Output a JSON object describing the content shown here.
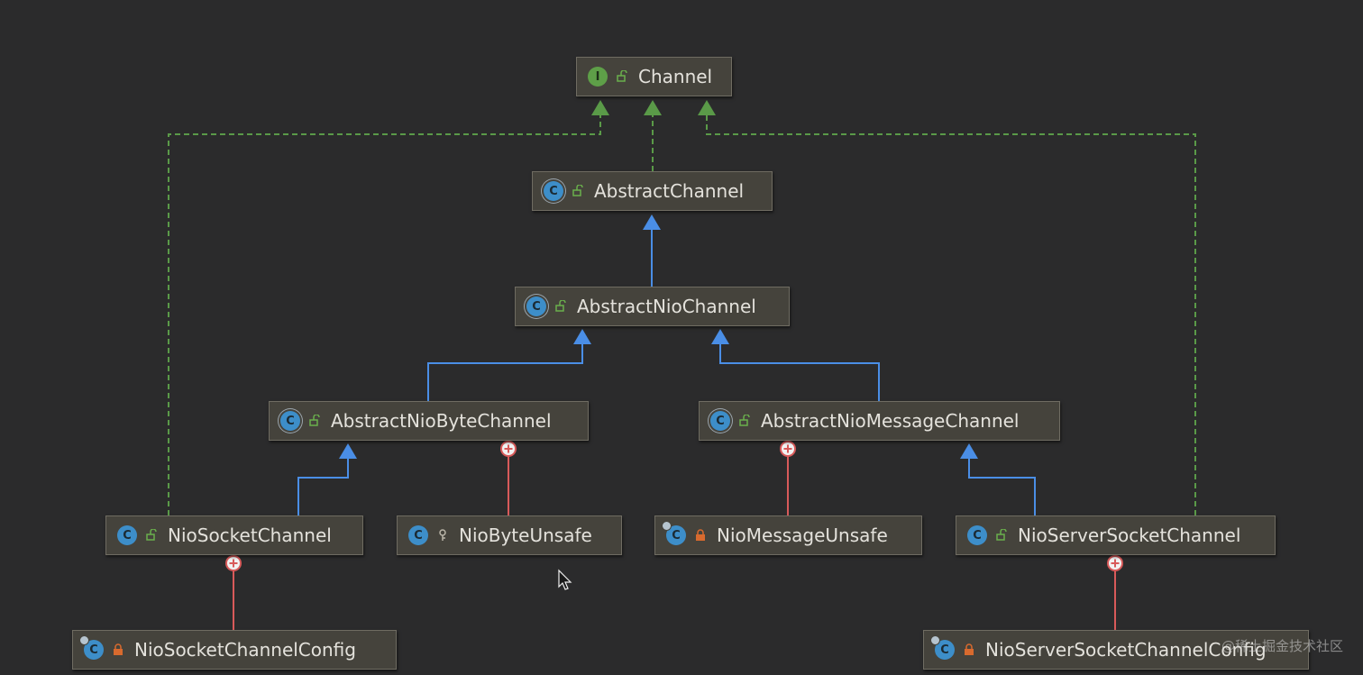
{
  "nodes": [
    {
      "id": "channel",
      "label": "Channel",
      "kind": "interface",
      "badge": "I",
      "visibility": "public"
    },
    {
      "id": "abstract-channel",
      "label": "AbstractChannel",
      "kind": "abstract-class",
      "badge": "C",
      "visibility": "public"
    },
    {
      "id": "abstract-nio-channel",
      "label": "AbstractNioChannel",
      "kind": "abstract-class",
      "badge": "C",
      "visibility": "public"
    },
    {
      "id": "abstract-nio-byte-channel",
      "label": "AbstractNioByteChannel",
      "kind": "abstract-class",
      "badge": "C",
      "visibility": "public"
    },
    {
      "id": "abstract-nio-message-channel",
      "label": "AbstractNioMessageChannel",
      "kind": "abstract-class",
      "badge": "C",
      "visibility": "public"
    },
    {
      "id": "nio-socket-channel",
      "label": "NioSocketChannel",
      "kind": "class",
      "badge": "C",
      "visibility": "public"
    },
    {
      "id": "nio-byte-unsafe",
      "label": "NioByteUnsafe",
      "kind": "class",
      "badge": "C",
      "visibility": "protected"
    },
    {
      "id": "nio-message-unsafe",
      "label": "NioMessageUnsafe",
      "kind": "inner-class",
      "badge": "C",
      "visibility": "private"
    },
    {
      "id": "nio-server-socket-channel",
      "label": "NioServerSocketChannel",
      "kind": "class",
      "badge": "C",
      "visibility": "public"
    },
    {
      "id": "nio-socket-channel-config",
      "label": "NioSocketChannelConfig",
      "kind": "inner-class",
      "badge": "C",
      "visibility": "private"
    },
    {
      "id": "nio-server-socket-channel-config",
      "label": "NioServerSocketChannelConfig",
      "kind": "inner-class",
      "badge": "C",
      "visibility": "private"
    }
  ],
  "edges": [
    {
      "from": "abstract-channel",
      "to": "channel",
      "type": "implements"
    },
    {
      "from": "nio-socket-channel",
      "to": "channel",
      "type": "implements"
    },
    {
      "from": "nio-server-socket-channel",
      "to": "channel",
      "type": "implements"
    },
    {
      "from": "abstract-nio-channel",
      "to": "abstract-channel",
      "type": "extends"
    },
    {
      "from": "abstract-nio-byte-channel",
      "to": "abstract-nio-channel",
      "type": "extends"
    },
    {
      "from": "abstract-nio-message-channel",
      "to": "abstract-nio-channel",
      "type": "extends"
    },
    {
      "from": "nio-socket-channel",
      "to": "abstract-nio-byte-channel",
      "type": "extends"
    },
    {
      "from": "nio-server-socket-channel",
      "to": "abstract-nio-message-channel",
      "type": "extends"
    },
    {
      "from": "nio-byte-unsafe",
      "to": "abstract-nio-byte-channel",
      "type": "inner"
    },
    {
      "from": "nio-message-unsafe",
      "to": "abstract-nio-message-channel",
      "type": "inner"
    },
    {
      "from": "nio-socket-channel-config",
      "to": "nio-socket-channel",
      "type": "inner"
    },
    {
      "from": "nio-server-socket-channel-config",
      "to": "nio-server-socket-channel",
      "type": "inner"
    }
  ],
  "colors": {
    "background": "#2b2b2c",
    "implements": "#5a9a48",
    "extends": "#4a8ee6",
    "inner": "#d85a5a"
  },
  "watermark": "@稀土掘金技术社区"
}
